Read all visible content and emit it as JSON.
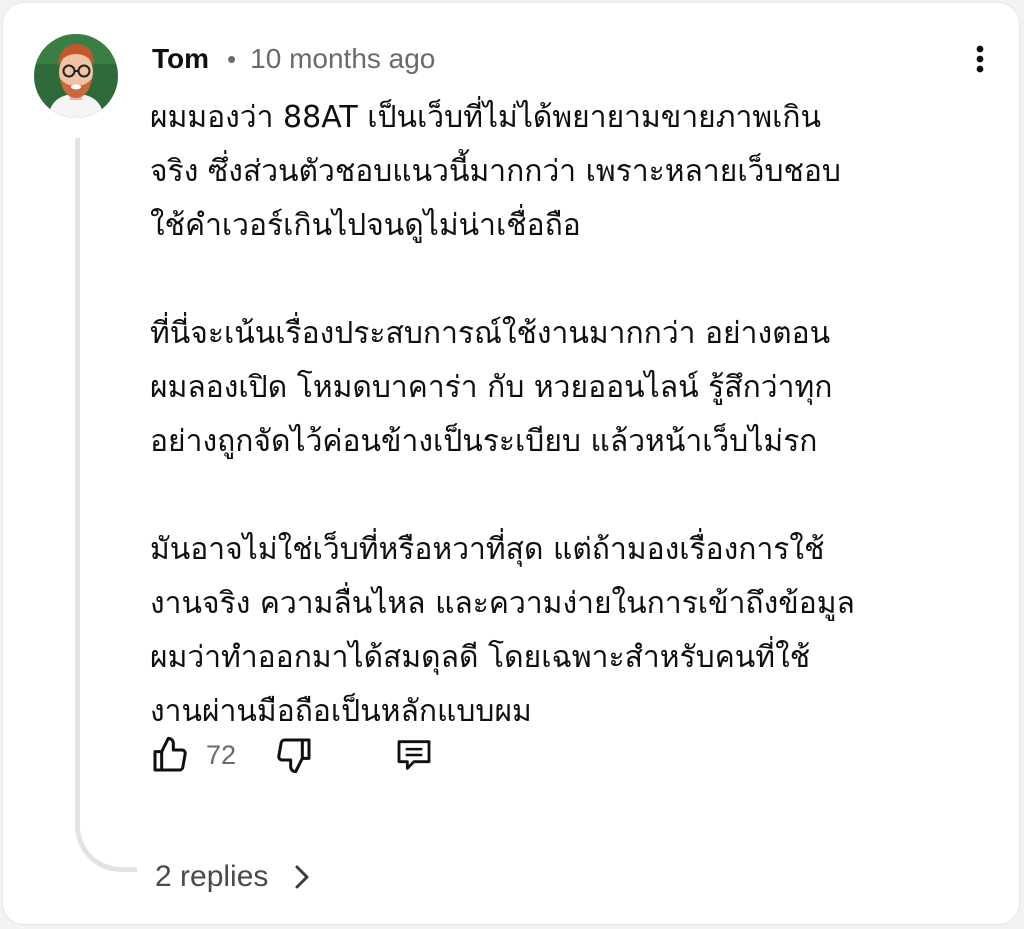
{
  "comment": {
    "author": "Tom",
    "separator": "•",
    "timestamp": "10 months ago",
    "paragraphs": [
      {
        "lines": [
          "ผมมองว่า 88AT เป็นเว็บที่ไม่ได้พยายามขายภาพเกิน",
          "จริง ซึ่งส่วนตัวชอบแนวนี้มากกว่า เพราะหลายเว็บชอบ",
          "ใช้คำเวอร์เกินไปจนดูไม่น่าเชื่อถือ"
        ]
      },
      {
        "lines": [
          "ที่นี่จะเน้นเรื่องประสบการณ์ใช้งานมากกว่า อย่างตอน",
          "ผมลองเปิด โหมดบาคาร่า กับ หวยออนไลน์ รู้สึกว่าทุก",
          "อย่างถูกจัดไว้ค่อนข้างเป็นระเบียบ แล้วหน้าเว็บไม่รก"
        ]
      },
      {
        "lines": [
          "มันอาจไม่ใช่เว็บที่หรือหวาที่สุด แต่ถ้ามองเรื่องการใช้",
          "งานจริง ความลื่นไหล และความง่ายในการเข้าถึงข้อมูล",
          "ผมว่าทำออกมาได้สมดุลดี โดยเฉพาะสำหรับคนที่ใช้",
          "งานผ่านมือถือเป็นหลักแบบผม"
        ]
      }
    ],
    "like_count": "72",
    "replies_label": "2 replies"
  },
  "icons": {
    "avatar": "avatar-photo",
    "menu": "more-vertical-icon",
    "like": "thumbs-up-icon",
    "dislike": "thumbs-down-icon",
    "reply": "comment-reply-icon",
    "expand": "chevron-right-icon"
  },
  "colors": {
    "background": "#ffffff",
    "text_primary": "#0f0f0f",
    "text_secondary": "#6a6a6a",
    "thread_line": "#e3e3e3"
  }
}
